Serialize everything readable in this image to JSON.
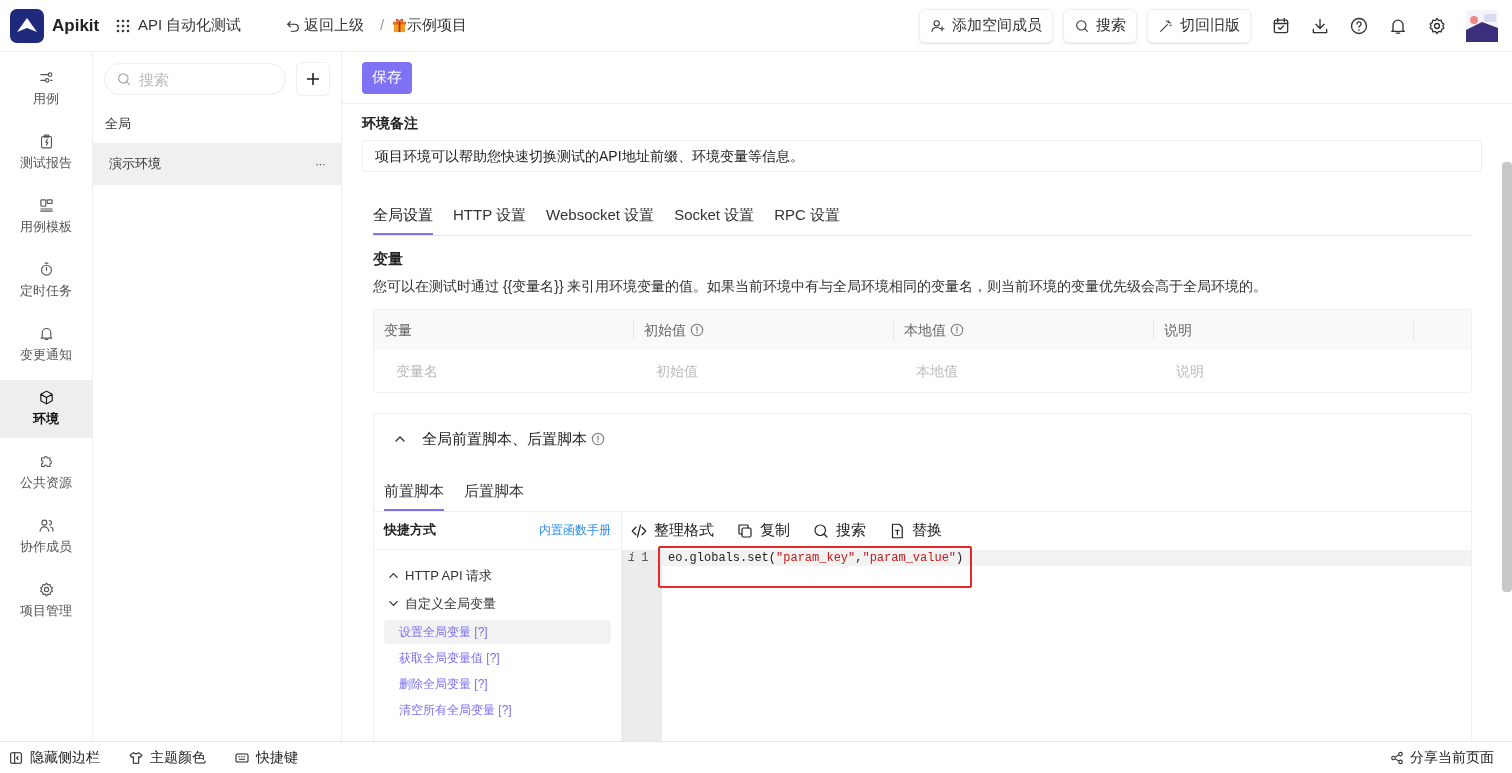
{
  "header": {
    "logo_text": "Apikit",
    "workspace": "API 自动化测试",
    "back": "返回上级",
    "separator": "/",
    "project": "示例项目",
    "actions": [
      {
        "kind": "invite",
        "label": "添加空间成员"
      },
      {
        "kind": "search",
        "label": "搜索"
      },
      {
        "kind": "wand",
        "label": "切回旧版"
      }
    ]
  },
  "nav": [
    {
      "kind": "cases",
      "label": "用例",
      "selected": false
    },
    {
      "kind": "report",
      "label": "测试报告",
      "selected": false
    },
    {
      "kind": "template",
      "label": "用例模板",
      "selected": false
    },
    {
      "kind": "timer",
      "label": "定时任务",
      "selected": false
    },
    {
      "kind": "bell",
      "label": "变更通知",
      "selected": false
    },
    {
      "kind": "cube",
      "label": "环境",
      "selected": true
    },
    {
      "kind": "puzzle",
      "label": "公共资源",
      "selected": false
    },
    {
      "kind": "users",
      "label": "协作成员",
      "selected": false
    },
    {
      "kind": "gear",
      "label": "项目管理",
      "selected": false
    }
  ],
  "env_list": {
    "search_placeholder": "搜索",
    "group": "全局",
    "items": [
      {
        "label": "演示环境",
        "selected": true,
        "more": "···"
      }
    ]
  },
  "main": {
    "save": "保存",
    "note_label": "环境备注",
    "note_value": "项目环境可以帮助您快速切换测试的API地址前缀、环境变量等信息。",
    "tabs": [
      {
        "label": "全局设置",
        "selected": true
      },
      {
        "label": "HTTP 设置",
        "selected": false
      },
      {
        "label": "Websocket 设置",
        "selected": false
      },
      {
        "label": "Socket 设置",
        "selected": false
      },
      {
        "label": "RPC 设置",
        "selected": false
      }
    ],
    "variables": {
      "title": "变量",
      "description": "您可以在测试时通过 {{变量名}} 来引用环境变量的值。如果当前环境中有与全局环境相同的变量名，则当前环境的变量优先级会高于全局环境的。",
      "columns": [
        {
          "label": "变量",
          "info": false
        },
        {
          "label": "初始值",
          "info": true
        },
        {
          "label": "本地值",
          "info": true
        },
        {
          "label": "说明",
          "info": false
        }
      ],
      "placeholders": [
        "变量名",
        "初始值",
        "本地值",
        "说明"
      ]
    },
    "script": {
      "title": "全局前置脚本、后置脚本",
      "expanded": true,
      "tabs": [
        {
          "label": "前置脚本",
          "selected": true
        },
        {
          "label": "后置脚本",
          "selected": false
        }
      ],
      "shortcuts_title": "快捷方式",
      "manual_link": "内置函数手册",
      "tree": [
        {
          "label": "HTTP API 请求",
          "expanded": false
        },
        {
          "label": "自定义全局变量",
          "expanded": true,
          "children": [
            {
              "label": "设置全局变量 [?]",
              "selected": true
            },
            {
              "label": "获取全局变量值 [?]",
              "selected": false
            },
            {
              "label": "删除全局变量 [?]",
              "selected": false
            },
            {
              "label": "清空所有全局变量 [?]",
              "selected": false
            }
          ]
        }
      ],
      "toolbar": [
        {
          "kind": "code",
          "label": "整理格式"
        },
        {
          "kind": "copy",
          "label": "复制"
        },
        {
          "kind": "search",
          "label": "搜索"
        },
        {
          "kind": "replace",
          "label": "替换"
        }
      ],
      "gutter_mark": "i",
      "line_number": "1",
      "code": [
        {
          "kind": "plain",
          "text": "eo.globals.set("
        },
        {
          "kind": "string",
          "text": "\"param_key\""
        },
        {
          "kind": "plain",
          "text": ","
        },
        {
          "kind": "string",
          "text": "\"param_value\""
        },
        {
          "kind": "plain",
          "text": ")"
        }
      ],
      "highlighted": true
    }
  },
  "footer": {
    "items": [
      {
        "kind": "sidebar",
        "label": "隐藏侧边栏"
      },
      {
        "kind": "shirt",
        "label": "主题颜色"
      },
      {
        "kind": "keyboard",
        "label": "快捷键"
      }
    ],
    "share": "分享当前页面"
  }
}
